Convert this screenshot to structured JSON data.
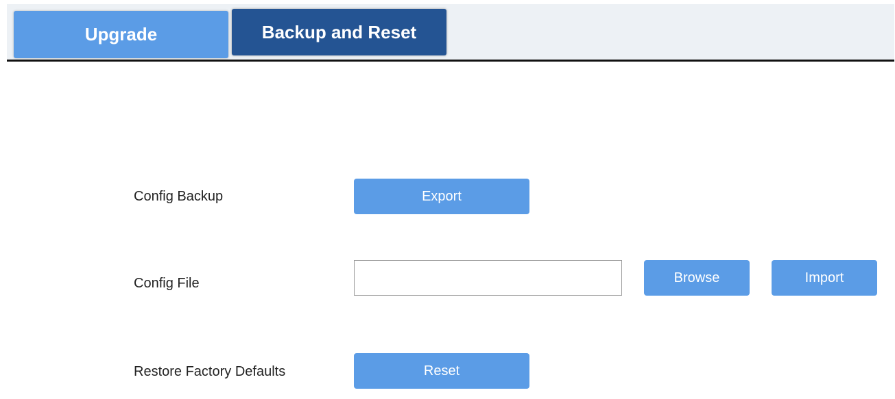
{
  "tabs": [
    {
      "label": "Upgrade"
    },
    {
      "label": "Backup and Reset"
    }
  ],
  "form": {
    "config_backup": {
      "label": "Config Backup",
      "button": "Export"
    },
    "config_file": {
      "label": "Config File",
      "value": "",
      "browse": "Browse",
      "import": "Import"
    },
    "restore_defaults": {
      "label": "Restore Factory Defaults",
      "button": "Reset"
    }
  },
  "colors": {
    "tab_inactive": "#5b9ce6",
    "tab_active": "#245493",
    "button": "#5b9ce6",
    "tabbar_bg": "#edf1f5"
  }
}
